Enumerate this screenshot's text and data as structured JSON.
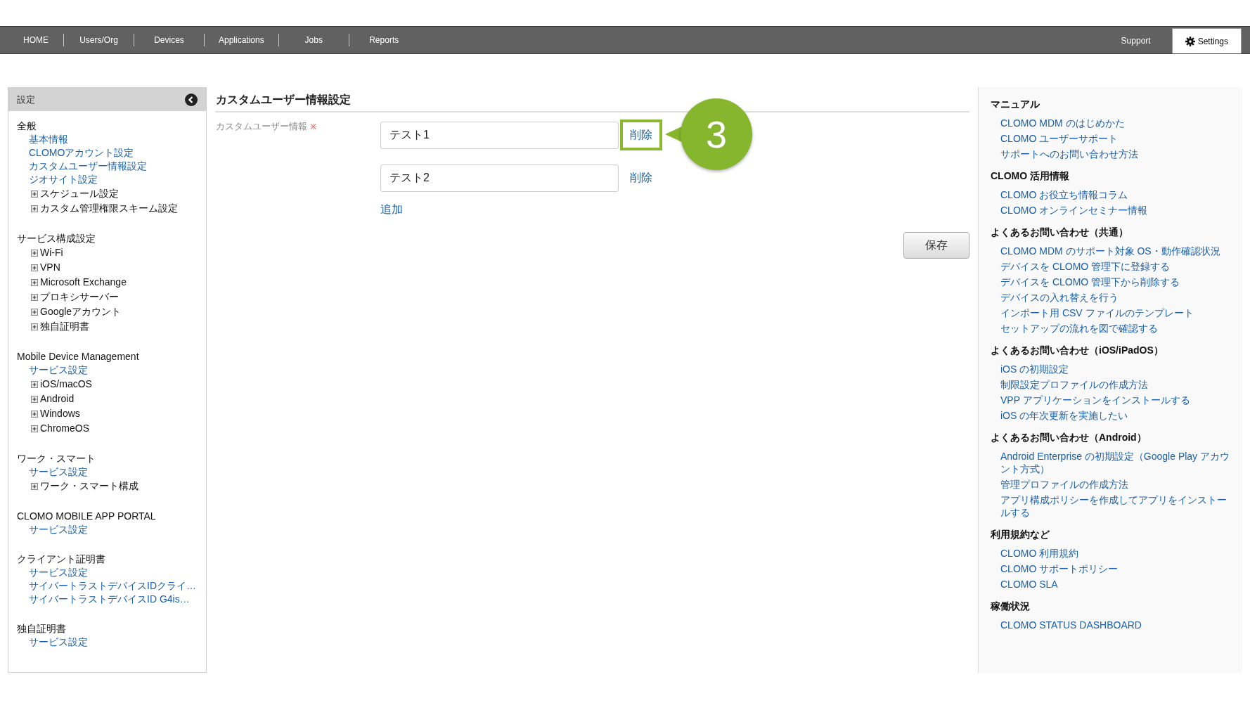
{
  "nav": {
    "tabs": [
      {
        "label": "HOME",
        "selected": false
      },
      {
        "label": "Users/Org",
        "selected": false
      },
      {
        "label": "Devices",
        "selected": false
      },
      {
        "label": "Applications",
        "selected": false
      },
      {
        "label": "Jobs",
        "selected": false
      },
      {
        "label": "Reports",
        "selected": false
      }
    ],
    "right_tabs": [
      {
        "label": "Support",
        "selected": false,
        "kind": "plain"
      },
      {
        "label": "Settings",
        "selected": true,
        "kind": "gear"
      }
    ]
  },
  "sidebar": {
    "title": "設定",
    "sections": [
      {
        "title": "全般",
        "items": [
          {
            "label": "基本情報",
            "kind": "link"
          },
          {
            "label": "CLOMOアカウント設定",
            "kind": "link"
          },
          {
            "label": "カスタムユーザー情報設定",
            "kind": "link"
          },
          {
            "label": "ジオサイト設定",
            "kind": "link"
          },
          {
            "label": "スケジュール設定",
            "kind": "expandable"
          },
          {
            "label": "カスタム管理権限スキーム設定",
            "kind": "expandable"
          }
        ]
      },
      {
        "title": "サービス構成設定",
        "items": [
          {
            "label": "Wi-Fi",
            "kind": "expandable"
          },
          {
            "label": "VPN",
            "kind": "expandable"
          },
          {
            "label": "Microsoft Exchange",
            "kind": "expandable"
          },
          {
            "label": "プロキシサーバー",
            "kind": "expandable"
          },
          {
            "label": "Googleアカウント",
            "kind": "expandable"
          },
          {
            "label": "独自証明書",
            "kind": "expandable"
          }
        ]
      },
      {
        "title": "Mobile Device Management",
        "items": [
          {
            "label": "サービス設定",
            "kind": "link"
          },
          {
            "label": "iOS/macOS",
            "kind": "expandable"
          },
          {
            "label": "Android",
            "kind": "expandable"
          },
          {
            "label": "Windows",
            "kind": "expandable"
          },
          {
            "label": "ChromeOS",
            "kind": "expandable"
          }
        ]
      },
      {
        "title": "ワーク・スマート",
        "items": [
          {
            "label": "サービス設定",
            "kind": "link"
          },
          {
            "label": "ワーク・スマート構成",
            "kind": "expandable"
          }
        ]
      },
      {
        "title": "CLOMO MOBILE APP PORTAL",
        "items": [
          {
            "label": "サービス設定",
            "kind": "link"
          }
        ]
      },
      {
        "title": "クライアント証明書",
        "items": [
          {
            "label": "サービス設定",
            "kind": "link"
          },
          {
            "label": "サイバートラストデバイスIDクライ…",
            "kind": "link"
          },
          {
            "label": "サイバートラストデバイスID G4is…",
            "kind": "link"
          }
        ]
      },
      {
        "title": "独自証明書",
        "items": [
          {
            "label": "サービス設定",
            "kind": "link"
          }
        ]
      }
    ]
  },
  "main": {
    "title": "カスタムユーザー情報設定",
    "field_label": "カスタムユーザー情報",
    "required_mark": "※",
    "entries": [
      {
        "value": "テスト1",
        "delete": "削除",
        "highlighted": true
      },
      {
        "value": "テスト2",
        "delete": "削除",
        "highlighted": false
      }
    ],
    "add": "追加",
    "save": "保存",
    "step_badge": "3"
  },
  "help": {
    "sections": [
      {
        "title": "マニュアル",
        "links": [
          "CLOMO MDM のはじめかた",
          "CLOMO ユーザーサポート",
          "サポートへのお問い合わせ方法"
        ]
      },
      {
        "title": "CLOMO 活用情報",
        "links": [
          "CLOMO お役立ち情報コラム",
          "CLOMO オンラインセミナー情報"
        ]
      },
      {
        "title": "よくあるお問い合わせ（共通）",
        "links": [
          "CLOMO MDM のサポート対象 OS・動作確認状況",
          "デバイスを CLOMO 管理下に登録する",
          "デバイスを CLOMO 管理下から削除する",
          "デバイスの入れ替えを行う",
          "インポート用 CSV ファイルのテンプレート",
          "セットアップの流れを図で確認する"
        ]
      },
      {
        "title": "よくあるお問い合わせ（iOS/iPadOS）",
        "links": [
          "iOS の初期設定",
          "制限設定プロファイルの作成方法",
          "VPP アプリケーションをインストールする",
          "iOS の年次更新を実施したい"
        ]
      },
      {
        "title": "よくあるお問い合わせ（Android）",
        "links": [
          "Android Enterprise の初期設定（Google Play アカウント方式）",
          "管理プロファイルの作成方法",
          "アプリ構成ポリシーを作成してアプリをインストールする"
        ]
      },
      {
        "title": "利用規約など",
        "links": [
          "CLOMO 利用規約",
          "CLOMO サポートポリシー",
          "CLOMO SLA"
        ]
      },
      {
        "title": "稼働状況",
        "links": [
          "CLOMO STATUS DASHBOARD"
        ]
      }
    ]
  }
}
